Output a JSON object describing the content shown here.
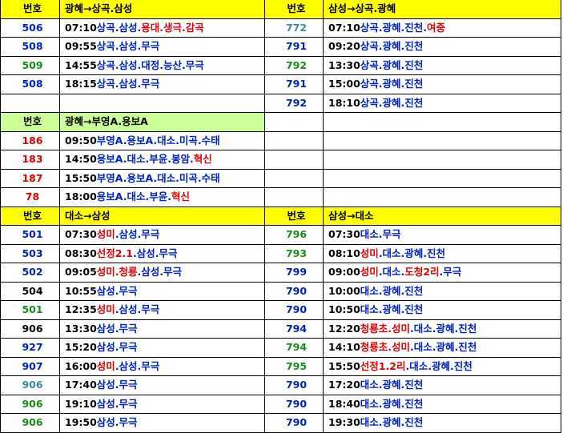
{
  "colors": {
    "blue": "#0020c0",
    "green": "#1a8a1a",
    "red": "#e00000",
    "teal": "#3a8a9a",
    "black": "#000000",
    "header_yellow": "#ffff00",
    "header_green": "#ccff99"
  },
  "rows": [
    {
      "type": "header",
      "fill": "yellow",
      "left": {
        "num": "번호",
        "route": "광혜→상곡.삼성"
      },
      "right": {
        "num": "번호",
        "route": "삼성→상곡.광혜"
      }
    },
    {
      "type": "data",
      "left": {
        "num": "506",
        "num_color": "blue",
        "parts": [
          [
            "07:10",
            "black"
          ],
          [
            "상곡.삼성.",
            "blue"
          ],
          [
            "용대.생극.감곡",
            "red"
          ]
        ]
      },
      "right": {
        "num": "772",
        "num_color": "teal",
        "parts": [
          [
            "07:10",
            "black"
          ],
          [
            "상곡.광혜.진천.",
            "blue"
          ],
          [
            "여중",
            "red"
          ]
        ]
      }
    },
    {
      "type": "data",
      "left": {
        "num": "508",
        "num_color": "blue",
        "parts": [
          [
            "09:55",
            "black"
          ],
          [
            "상곡.삼성.무극",
            "blue"
          ]
        ]
      },
      "right": {
        "num": "791",
        "num_color": "blue",
        "parts": [
          [
            "09:20",
            "black"
          ],
          [
            "상곡.광혜.진천",
            "blue"
          ]
        ]
      }
    },
    {
      "type": "data",
      "left": {
        "num": "509",
        "num_color": "green",
        "parts": [
          [
            "14:55",
            "black"
          ],
          [
            "상곡.삼성.대정.능산.무극",
            "blue"
          ]
        ]
      },
      "right": {
        "num": "792",
        "num_color": "green",
        "parts": [
          [
            "13:30",
            "black"
          ],
          [
            "상곡.광혜.진천",
            "blue"
          ]
        ]
      }
    },
    {
      "type": "data",
      "left": {
        "num": "508",
        "num_color": "blue",
        "parts": [
          [
            "18:15",
            "black"
          ],
          [
            "상곡.삼성.무극",
            "blue"
          ]
        ]
      },
      "right": {
        "num": "791",
        "num_color": "blue",
        "parts": [
          [
            "15:00",
            "black"
          ],
          [
            "상곡.광혜.진천",
            "blue"
          ]
        ]
      }
    },
    {
      "type": "data",
      "left": {
        "num": "",
        "num_color": "blue",
        "parts": []
      },
      "right": {
        "num": "792",
        "num_color": "blue",
        "parts": [
          [
            "18:10",
            "black"
          ],
          [
            "상곡.광혜.진천",
            "blue"
          ]
        ]
      }
    },
    {
      "type": "header",
      "fill": "green",
      "left": {
        "num": "번호",
        "route": "광혜→부영A.용보A"
      },
      "right": null
    },
    {
      "type": "data",
      "left": {
        "num": "186",
        "num_color": "red",
        "parts": [
          [
            "09:50",
            "black"
          ],
          [
            "부영A.용보A.대소.미곡.수태",
            "blue"
          ]
        ]
      },
      "right": null
    },
    {
      "type": "data",
      "left": {
        "num": "183",
        "num_color": "red",
        "parts": [
          [
            "14:50",
            "black"
          ],
          [
            "용보A.대소.부윤.봉암.",
            "blue"
          ],
          [
            "혁신",
            "red"
          ]
        ]
      },
      "right": null
    },
    {
      "type": "data",
      "left": {
        "num": "187",
        "num_color": "red",
        "parts": [
          [
            "15:50",
            "black"
          ],
          [
            "부영A.용보A.대소.미곡.수태",
            "blue"
          ]
        ]
      },
      "right": null
    },
    {
      "type": "data",
      "left": {
        "num": "78",
        "num_color": "red",
        "parts": [
          [
            "18:00",
            "black"
          ],
          [
            "용보A.대소.부윤.",
            "blue"
          ],
          [
            "혁신",
            "red"
          ]
        ]
      },
      "right": null
    },
    {
      "type": "header",
      "fill": "yellow",
      "left": {
        "num": "번호",
        "route": "대소→삼성"
      },
      "right": {
        "num": "번호",
        "route": "삼성→대소"
      }
    },
    {
      "type": "data",
      "left": {
        "num": "501",
        "num_color": "blue",
        "parts": [
          [
            "07:30",
            "black"
          ],
          [
            "성미",
            "red"
          ],
          [
            ".삼성.무극",
            "blue"
          ]
        ]
      },
      "right": {
        "num": "796",
        "num_color": "green",
        "parts": [
          [
            "07:30",
            "black"
          ],
          [
            "대소.무극",
            "blue"
          ]
        ]
      }
    },
    {
      "type": "data",
      "left": {
        "num": "503",
        "num_color": "blue",
        "parts": [
          [
            "08:30",
            "black"
          ],
          [
            "선정2.1",
            "red"
          ],
          [
            ".삼성.무극",
            "blue"
          ]
        ]
      },
      "right": {
        "num": "793",
        "num_color": "green",
        "parts": [
          [
            "08:10",
            "black"
          ],
          [
            "성미",
            "red"
          ],
          [
            ".대소.광혜.진천",
            "blue"
          ]
        ]
      }
    },
    {
      "type": "data",
      "left": {
        "num": "502",
        "num_color": "blue",
        "parts": [
          [
            "09:05",
            "black"
          ],
          [
            "성미.청룡",
            "red"
          ],
          [
            ".삼성.무극",
            "blue"
          ]
        ]
      },
      "right": {
        "num": "799",
        "num_color": "blue",
        "parts": [
          [
            "09:00",
            "black"
          ],
          [
            "성미",
            "red"
          ],
          [
            ".대소.",
            "blue"
          ],
          [
            "도청2리",
            "red"
          ],
          [
            ".무극",
            "blue"
          ]
        ]
      }
    },
    {
      "type": "data",
      "left": {
        "num": "504",
        "num_color": "black",
        "parts": [
          [
            "10:55",
            "black"
          ],
          [
            "삼성.무극",
            "blue"
          ]
        ]
      },
      "right": {
        "num": "790",
        "num_color": "blue",
        "parts": [
          [
            "10:00",
            "black"
          ],
          [
            "대소.광혜.진천",
            "blue"
          ]
        ]
      }
    },
    {
      "type": "data",
      "left": {
        "num": "501",
        "num_color": "green",
        "parts": [
          [
            "12:35",
            "black"
          ],
          [
            "성미",
            "red"
          ],
          [
            ".삼성.무극",
            "blue"
          ]
        ]
      },
      "right": {
        "num": "790",
        "num_color": "blue",
        "parts": [
          [
            "10:50",
            "black"
          ],
          [
            "대소.광혜.진천",
            "blue"
          ]
        ]
      }
    },
    {
      "type": "data",
      "left": {
        "num": "906",
        "num_color": "black",
        "parts": [
          [
            "13:30",
            "black"
          ],
          [
            "삼성.무극",
            "blue"
          ]
        ]
      },
      "right": {
        "num": "794",
        "num_color": "blue",
        "parts": [
          [
            "12:20",
            "black"
          ],
          [
            "청룡초.성미",
            "red"
          ],
          [
            ".대소.광혜.진천",
            "blue"
          ]
        ]
      }
    },
    {
      "type": "data",
      "left": {
        "num": "927",
        "num_color": "blue",
        "parts": [
          [
            "15:20",
            "black"
          ],
          [
            "삼성.무극",
            "blue"
          ]
        ]
      },
      "right": {
        "num": "794",
        "num_color": "green",
        "parts": [
          [
            "14:10",
            "black"
          ],
          [
            "청룡초.성미",
            "red"
          ],
          [
            ".대소.광혜.진천",
            "blue"
          ]
        ]
      }
    },
    {
      "type": "data",
      "left": {
        "num": "907",
        "num_color": "blue",
        "parts": [
          [
            "16:00",
            "black"
          ],
          [
            "성미",
            "red"
          ],
          [
            ".삼성.무극",
            "blue"
          ]
        ]
      },
      "right": {
        "num": "795",
        "num_color": "green",
        "parts": [
          [
            "15:50",
            "black"
          ],
          [
            "선정1.2리",
            "red"
          ],
          [
            ".대소.광혜.진천",
            "blue"
          ]
        ]
      }
    },
    {
      "type": "data",
      "left": {
        "num": "906",
        "num_color": "teal",
        "parts": [
          [
            "17:40",
            "black"
          ],
          [
            "삼성.무극",
            "blue"
          ]
        ]
      },
      "right": {
        "num": "790",
        "num_color": "blue",
        "parts": [
          [
            "17:20",
            "black"
          ],
          [
            "대소.광혜.진천",
            "blue"
          ]
        ]
      }
    },
    {
      "type": "data",
      "left": {
        "num": "906",
        "num_color": "green",
        "parts": [
          [
            "19:10",
            "black"
          ],
          [
            "삼성.무극",
            "blue"
          ]
        ]
      },
      "right": {
        "num": "790",
        "num_color": "blue",
        "parts": [
          [
            "18:40",
            "black"
          ],
          [
            "대소.광혜.진천",
            "blue"
          ]
        ]
      }
    },
    {
      "type": "data",
      "left": {
        "num": "906",
        "num_color": "green",
        "parts": [
          [
            "19:50",
            "black"
          ],
          [
            "삼성.무극",
            "blue"
          ]
        ]
      },
      "right": {
        "num": "790",
        "num_color": "blue",
        "parts": [
          [
            "19:30",
            "black"
          ],
          [
            "대소.광혜.진천",
            "blue"
          ]
        ]
      }
    }
  ]
}
